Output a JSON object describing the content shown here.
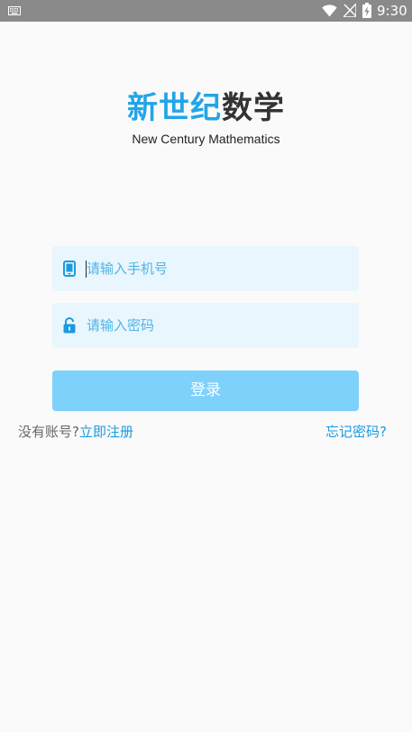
{
  "status_bar": {
    "time": "9:30",
    "icons": [
      "keyboard-icon",
      "wifi-icon",
      "no-signal-icon",
      "battery-charging-icon"
    ]
  },
  "logo": {
    "title_part_a": "新世纪",
    "title_part_b": "数学",
    "subtitle": "New Century Mathematics"
  },
  "login_form": {
    "phone_placeholder": "请输入手机号",
    "password_placeholder": "请输入密码",
    "phone_icon": "phone-icon",
    "password_icon": "lock-icon",
    "login_label": "登录"
  },
  "links": {
    "no_account": "没有账号?",
    "register": "立即注册",
    "forgot_password": "忘记密码?"
  },
  "colors": {
    "accent": "#22a5e8",
    "field_bg": "#e9f6fd",
    "button_bg": "#7dd1fb",
    "link": "#1a9be0",
    "status_bar": "#8a8a8a"
  }
}
